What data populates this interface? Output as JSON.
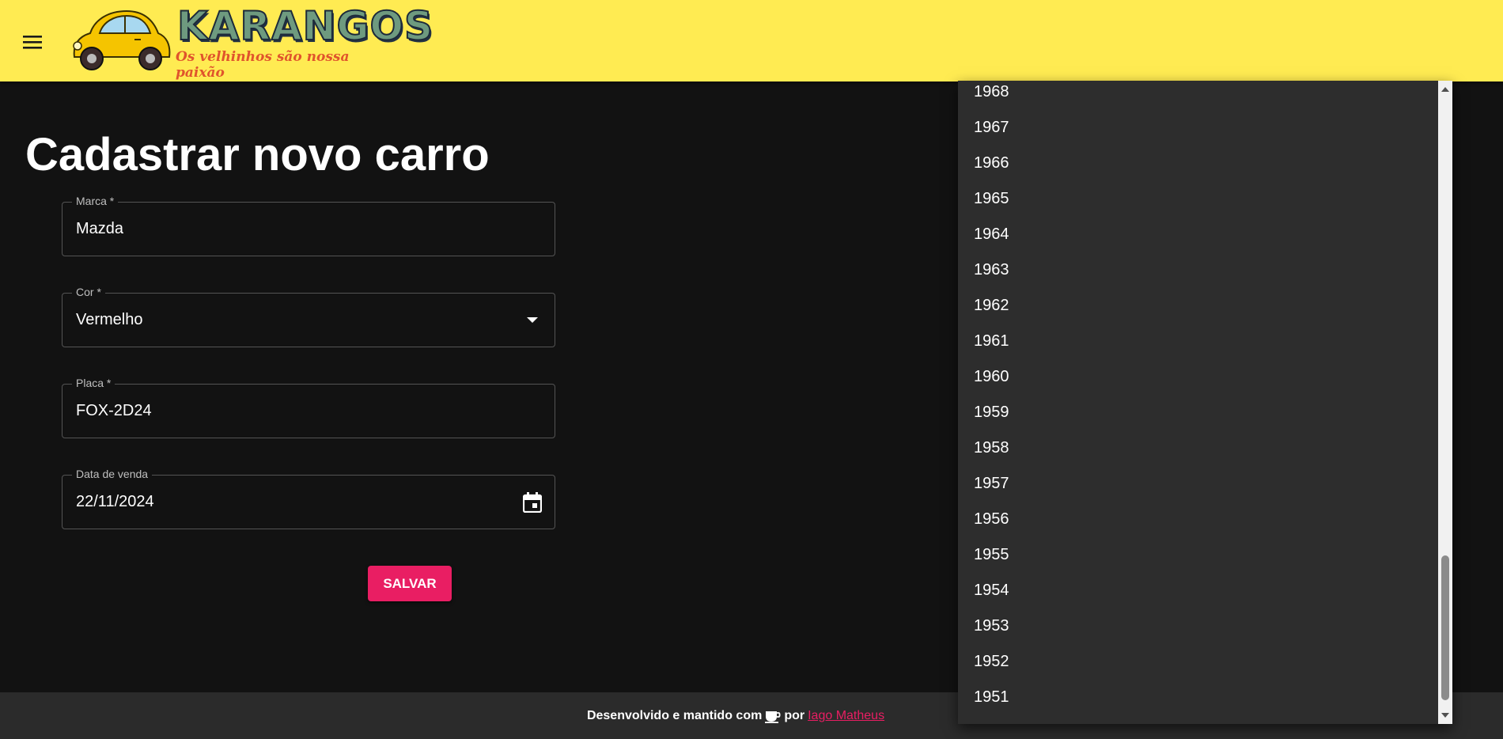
{
  "appbar": {
    "brand": "KARANGOS",
    "tagline": "Os velhinhos são nossa paixão"
  },
  "page": {
    "title": "Cadastrar novo carro"
  },
  "form": {
    "marca": {
      "label": "Marca *",
      "value": "Mazda"
    },
    "cor": {
      "label": "Cor *",
      "value": "Vermelho"
    },
    "placa": {
      "label": "Placa *",
      "value": "FOX-2D24"
    },
    "data_venda": {
      "label": "Data de venda",
      "value": "22/11/2024"
    },
    "save_label": "SALVAR"
  },
  "year_options": [
    "1968",
    "1967",
    "1966",
    "1965",
    "1964",
    "1963",
    "1962",
    "1961",
    "1960",
    "1959",
    "1958",
    "1957",
    "1956",
    "1955",
    "1954",
    "1953",
    "1952",
    "1951"
  ],
  "footer": {
    "text_before": "Desenvolvido e mantido com",
    "text_por": "por",
    "author": "Iago Matheus"
  },
  "colors": {
    "appbar_bg": "#ffeb52",
    "accent": "#e91e63",
    "page_bg": "#121212",
    "dropdown_bg": "#2d2d2d"
  }
}
